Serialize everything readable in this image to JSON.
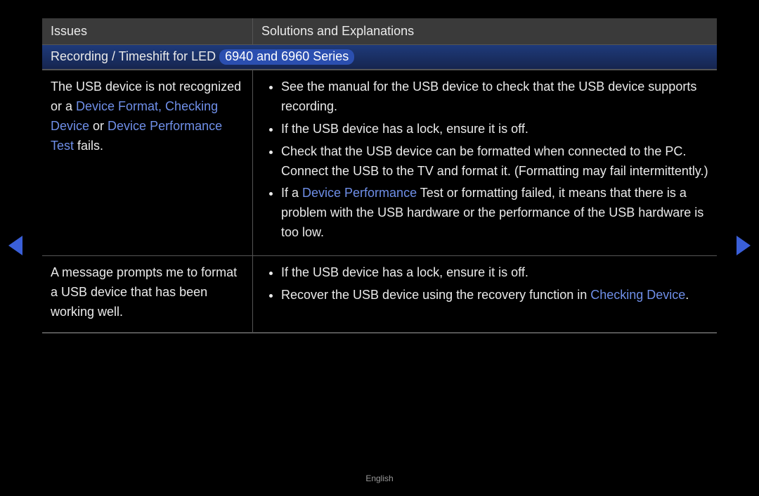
{
  "headers": {
    "issues": "Issues",
    "solutions": "Solutions and Explanations"
  },
  "section": {
    "title_prefix": "Recording / Timeshift for LED ",
    "tag": "6940 and 6960 Series"
  },
  "rows": [
    {
      "issue": {
        "pre": "The USB device is not recognized or a ",
        "hl1": "Device Format, Checking Device",
        "mid": " or ",
        "hl2": "Device Performance Test",
        "post": " fails."
      },
      "solutions": [
        {
          "t": "See the manual for the USB device to check that the USB device supports recording."
        },
        {
          "t": "If the USB device has a lock, ensure it is off."
        },
        {
          "t": "Check that the USB device can be formatted when connected to the PC. Connect the USB to the TV and format it. (Formatting may fail intermittently.)"
        },
        {
          "pre": "If a ",
          "hl": "Device Performance",
          "post": " Test or formatting failed, it means that there is a problem with the USB hardware or the performance of the USB hardware is too low."
        }
      ]
    },
    {
      "issue": {
        "pre": "A message prompts me to format a USB device that has been working well."
      },
      "solutions": [
        {
          "t": "If the USB device has a lock, ensure it is off."
        },
        {
          "pre": "Recover the USB device using the recovery function in ",
          "hl": "Checking Device",
          "post": "."
        }
      ]
    }
  ],
  "footer": "English"
}
